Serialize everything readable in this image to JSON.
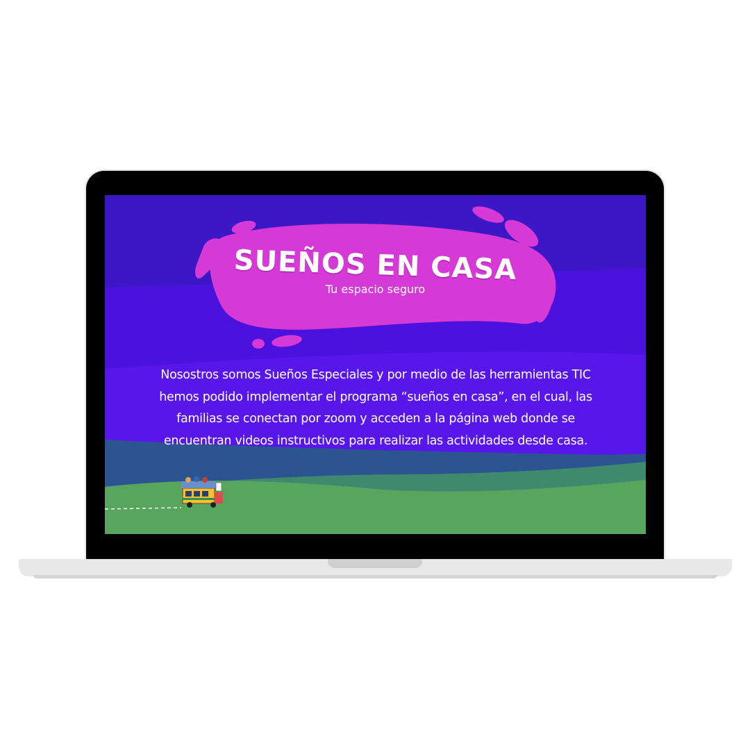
{
  "slide": {
    "title": "SUEÑOS EN CASA",
    "subtitle": "Tu espacio seguro",
    "body": "Nosostros somos Sueños Especiales y por medio de las herramientas TIC hemos podido implementar el programa “sueños en casa”, en el cual, las familias se conectan por zoom y acceden a la página web donde se encuentran videos instructivos para realizar las actividades desde casa."
  },
  "colors": {
    "sky_top": "#3c17c6",
    "sky_mid": "#4a12dc",
    "sky_low": "#5a16ec",
    "blob": "#d63ad6",
    "hill_blue": "#2b5490",
    "hill_teal": "#3f8a6f",
    "hill_green": "#58a560"
  },
  "icons": {
    "vehicle": "chiva-bus-icon"
  }
}
